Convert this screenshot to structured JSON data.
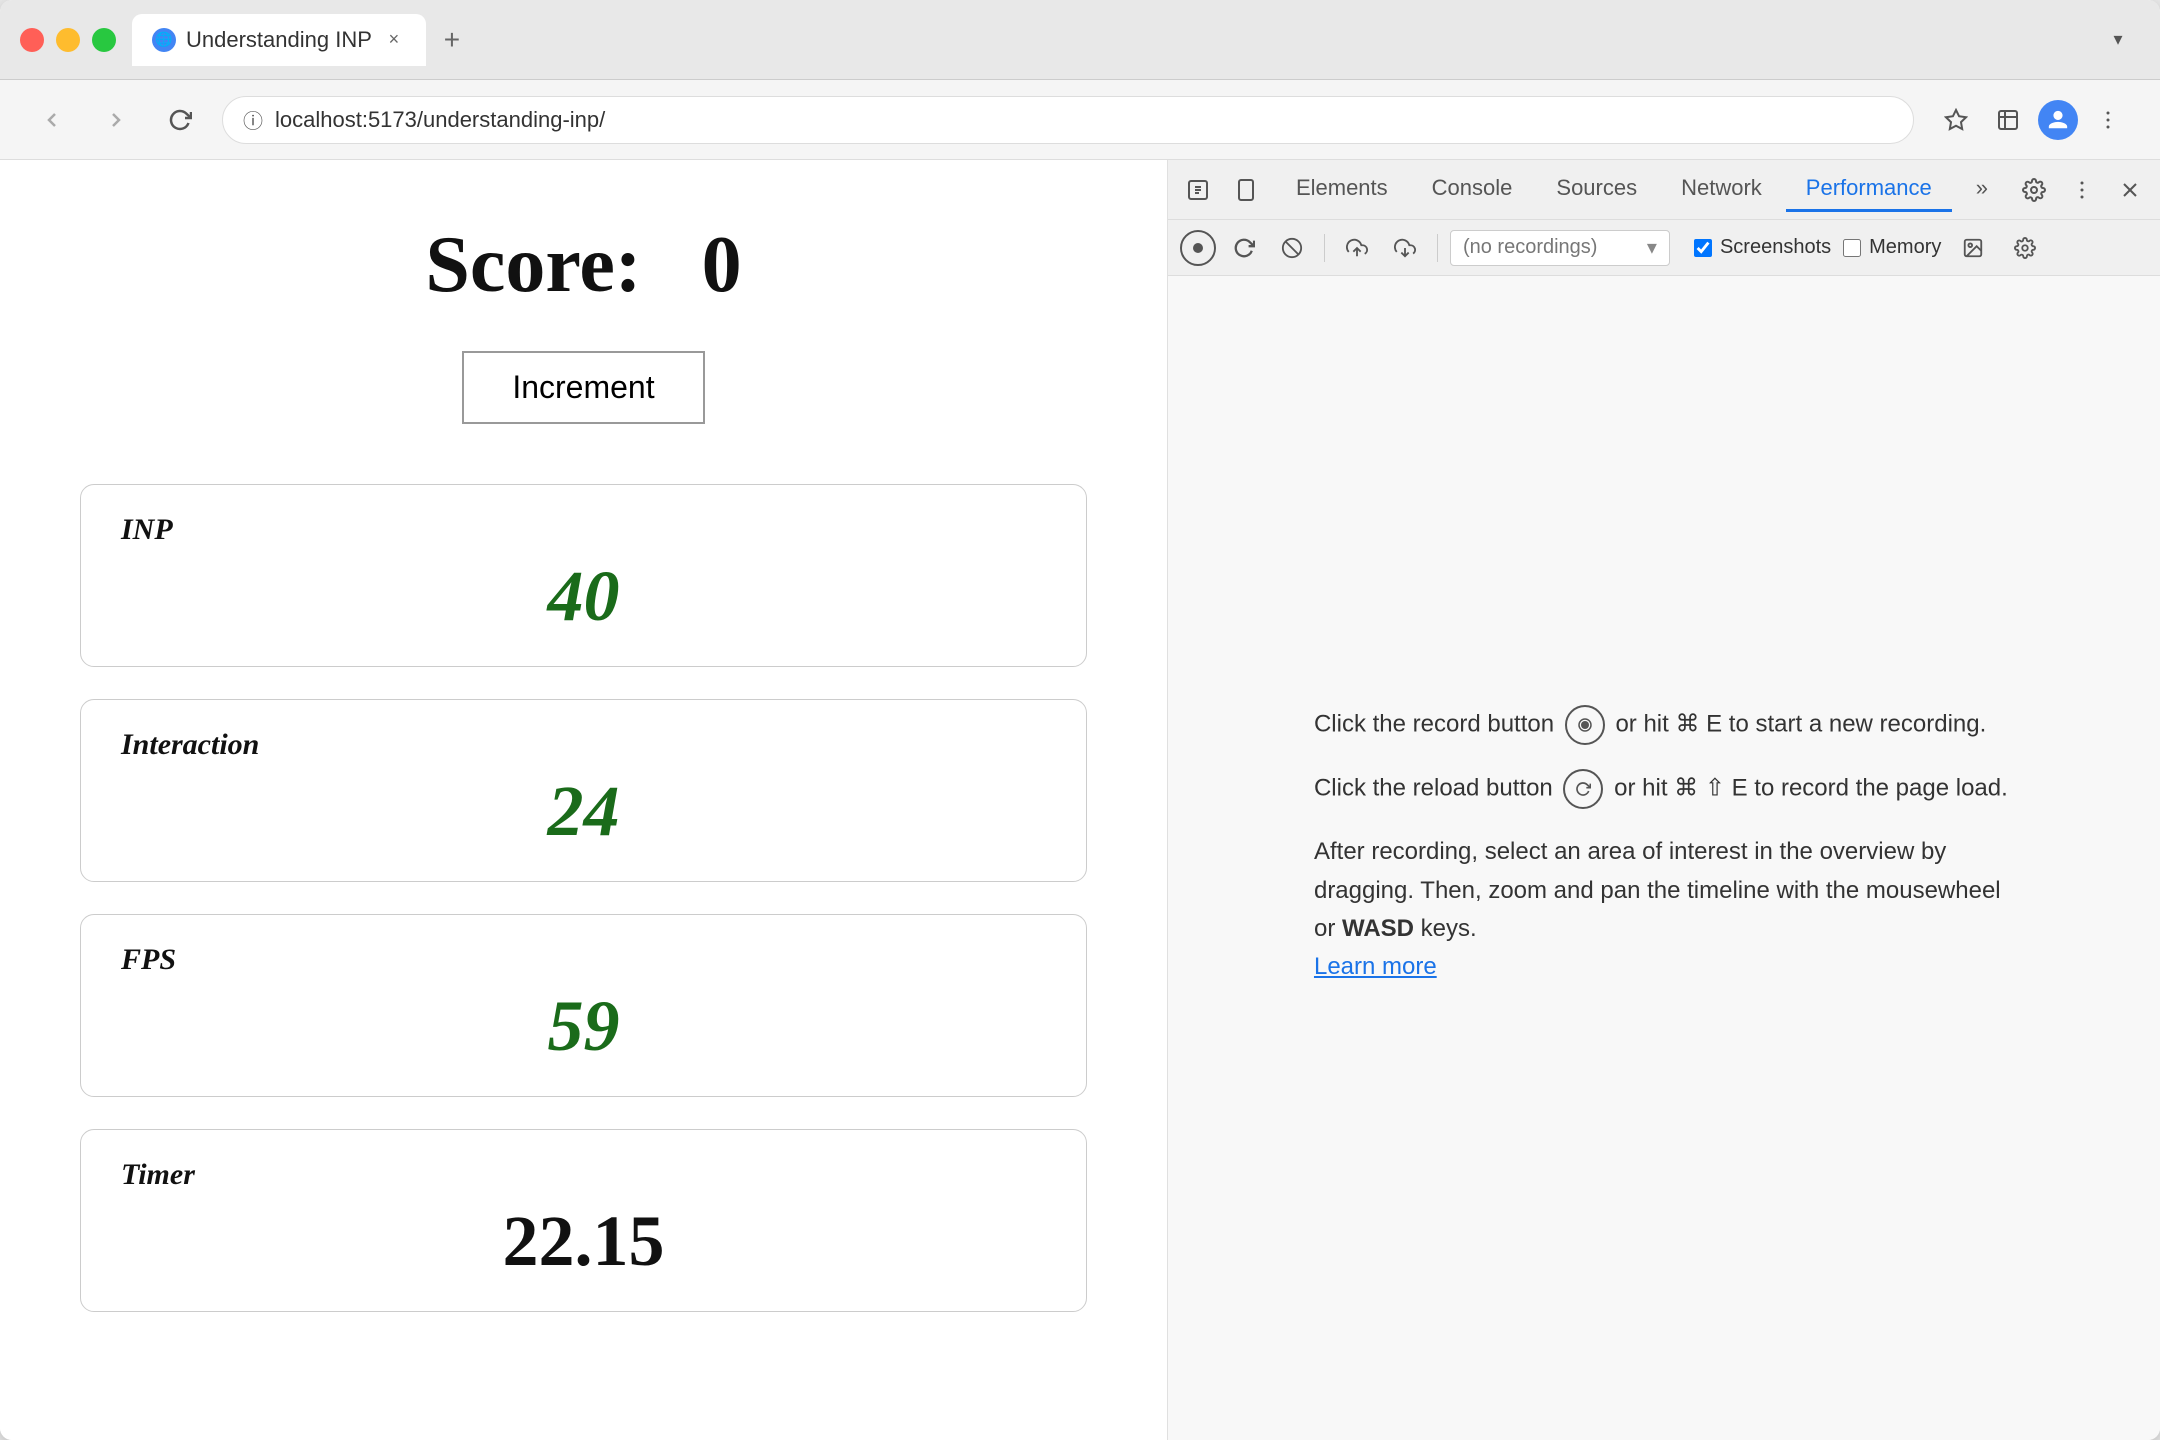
{
  "browser": {
    "tab_title": "Understanding INP",
    "url": "localhost:5173/understanding-inp/",
    "tab_close": "×",
    "tab_add": "+",
    "tab_dropdown_label": "▾"
  },
  "nav": {
    "back_label": "‹",
    "forward_label": "›",
    "reload_label": "↻",
    "url_icon": "ⓘ"
  },
  "toolbar": {
    "bookmark_label": "☆",
    "extension_label": "⚗",
    "account_label": "👤",
    "menu_label": "⋮"
  },
  "webpage": {
    "score_label": "Score:",
    "score_value": "0",
    "increment_button": "Increment",
    "metrics": [
      {
        "id": "inp",
        "label": "INP",
        "value": "40",
        "type": "green"
      },
      {
        "id": "interaction",
        "label": "Interaction",
        "value": "24",
        "type": "green"
      },
      {
        "id": "fps",
        "label": "FPS",
        "value": "59",
        "type": "green"
      },
      {
        "id": "timer",
        "label": "Timer",
        "value": "22.15",
        "type": "timer"
      }
    ]
  },
  "devtools": {
    "tabs": [
      {
        "id": "elements",
        "label": "Elements",
        "active": false
      },
      {
        "id": "console",
        "label": "Console",
        "active": false
      },
      {
        "id": "sources",
        "label": "Sources",
        "active": false
      },
      {
        "id": "network",
        "label": "Network",
        "active": false
      },
      {
        "id": "performance",
        "label": "Performance",
        "active": true
      },
      {
        "id": "more",
        "label": "»",
        "active": false
      }
    ],
    "settings_label": "⚙",
    "more_options_label": "⋮",
    "close_label": "×",
    "perf_toolbar": {
      "record_label": "⏺",
      "reload_label": "↻",
      "clear_label": "⊘",
      "upload_label": "⬆",
      "download_label": "⬇",
      "recordings_placeholder": "(no recordings)",
      "screenshots_label": "Screenshots",
      "memory_label": "Memory",
      "screenshots_checked": true,
      "memory_checked": false,
      "capture_screenshots_label": "📷",
      "settings_label": "⚙"
    },
    "instructions": {
      "line1_before": "Click the record button",
      "line1_record_icon": "⏺",
      "line1_after": "or hit ⌘ E to start a new recording.",
      "line2_before": "Click the reload button",
      "line2_reload_icon": "↻",
      "line2_after": "or hit ⌘ ⇧ E to record the page load.",
      "line3": "After recording, select an area of interest in the overview by dragging. Then, zoom and pan the timeline with the mousewheel or ",
      "line3_bold": "WASD",
      "line3_end": " keys.",
      "learn_more_label": "Learn more"
    }
  }
}
